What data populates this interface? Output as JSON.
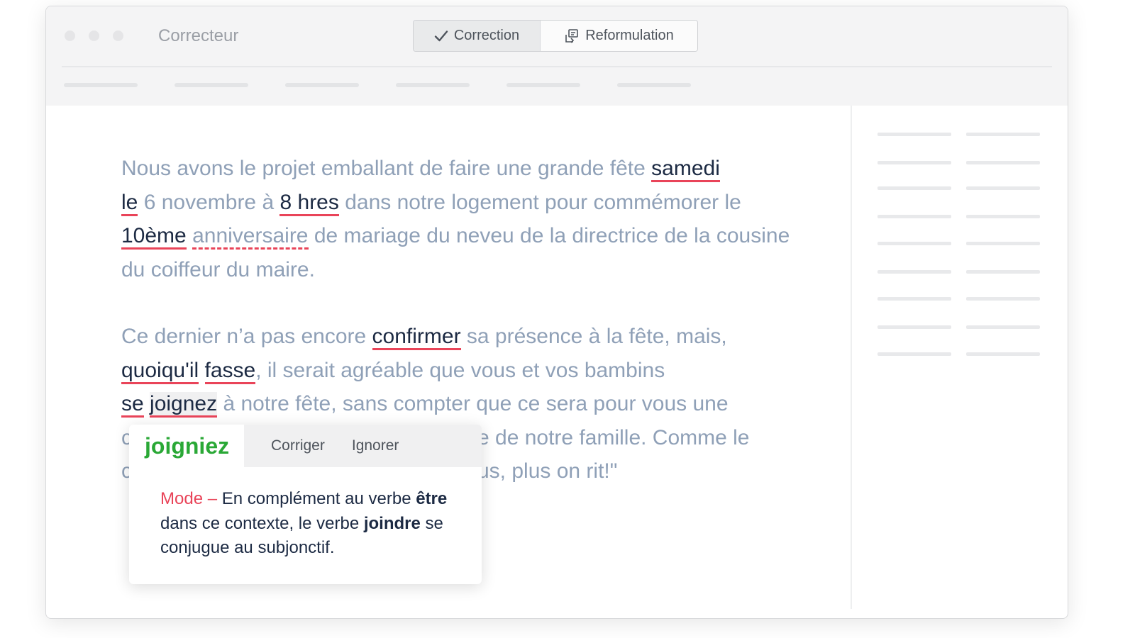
{
  "app": {
    "title": "Correcteur"
  },
  "modes": {
    "correction": "Correction",
    "reformulation": "Reformulation"
  },
  "colors": {
    "error_underline": "#e94459",
    "suggestion": "#2aa836",
    "text_muted": "#8fa0b7",
    "text_error": "#1c2a43"
  },
  "editor": {
    "p1": {
      "t1": "Nous avons le projet emballant de faire une grande fête ",
      "e1": "samedi",
      "e2": "le",
      "t2": " 6 novembre à ",
      "e3": "8 hres",
      "t3": " dans notre logement pour commémorer le ",
      "e4": "10ème",
      "w1": "anniversaire",
      "t4": " de mariage du neveu de la directrice de la cousine du coiffeur du maire."
    },
    "p2": {
      "t1": "Ce dernier n’a pas encore ",
      "e1": "confirmer",
      "t2": " sa présence à la fête, mais, ",
      "e2": "quoiqu'il",
      "e3": "fasse",
      "t3": ", il serait agréable que vous et vos bambins ",
      "e4": "se",
      "e5": "joignez",
      "t4": " à notre fête, sans compter que ce sera pour vous une ",
      "t5": "c",
      "t6": "e de notre famille. Comme le ",
      "t7": "c",
      "t8": "us, plus on rit!\""
    }
  },
  "popup": {
    "suggestion": "joigniez",
    "correct_label": "Corriger",
    "ignore_label": "Ignorer",
    "desc_label": "Mode –",
    "desc_t1": " En complément au verbe ",
    "desc_b1": "être",
    "desc_t2": " dans ce contexte, le verbe ",
    "desc_b2": "joindre",
    "desc_t3": " se conjugue au subjonctif."
  }
}
